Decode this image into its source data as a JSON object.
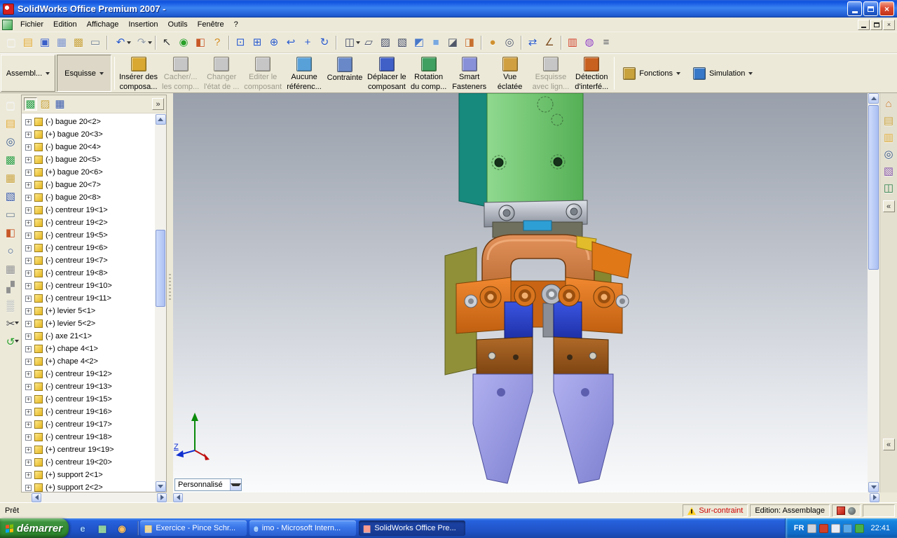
{
  "colors": {
    "titlebar_blue": "#1c5ae0",
    "taskbar_blue": "#245edb",
    "start_green": "#2f8a2f",
    "warning_red": "#cc0000",
    "viewport_gradient_top": "#99a0ab",
    "viewport_gradient_bottom": "#fafbfc",
    "ui_face": "#ece9d8"
  },
  "window": {
    "title": "SolidWorks Office Premium 2007 -",
    "controls": {
      "close": "×"
    }
  },
  "menu_bar": {
    "items": [
      {
        "name": "menu-fichier",
        "label": "Fichier"
      },
      {
        "name": "menu-edition",
        "label": "Edition"
      },
      {
        "name": "menu-affichage",
        "label": "Affichage"
      },
      {
        "name": "menu-insertion",
        "label": "Insertion"
      },
      {
        "name": "menu-outils",
        "label": "Outils"
      },
      {
        "name": "menu-fenetre",
        "label": "Fenêtre"
      },
      {
        "name": "menu-aide",
        "label": "?"
      }
    ]
  },
  "standard_toolbar": {
    "icons": [
      {
        "name": "new-icon",
        "g": "▢",
        "c": "#f0f0f0"
      },
      {
        "name": "open-icon",
        "g": "▤",
        "c": "#e0a830"
      },
      {
        "name": "save-icon",
        "g": "▣",
        "c": "#3a5fc8"
      },
      {
        "name": "make-drawing-icon",
        "g": "▦",
        "c": "#7890c8"
      },
      {
        "name": "make-assembly-icon",
        "g": "▩",
        "c": "#c8a23c"
      },
      {
        "name": "print-icon",
        "g": "▭",
        "c": "#708090"
      },
      {
        "name": "toolbar-separator",
        "cls": "sep"
      },
      {
        "name": "undo-icon",
        "g": "↶",
        "c": "#2858c8",
        "dd": 1
      },
      {
        "name": "redo-icon",
        "g": "↷",
        "c": "#98a0a8",
        "dd": 1
      },
      {
        "name": "toolbar-separator",
        "cls": "sep"
      },
      {
        "name": "select-icon",
        "g": "↖",
        "c": "#303030"
      },
      {
        "name": "rebuild-icon",
        "g": "◉",
        "c": "#28a028"
      },
      {
        "name": "appearance-icon",
        "g": "◧",
        "c": "#c85828"
      },
      {
        "name": "help-icon",
        "g": "?",
        "c": "#d08818"
      },
      {
        "name": "toolbar-separator",
        "cls": "sep"
      },
      {
        "name": "zoom-fit-icon",
        "g": "⊡",
        "c": "#2858c8"
      },
      {
        "name": "zoom-area-icon",
        "g": "⊞",
        "c": "#2858c8"
      },
      {
        "name": "zoom-in-out-icon",
        "g": "⊕",
        "c": "#2858c8"
      },
      {
        "name": "previous-view-icon",
        "g": "↩",
        "c": "#2858c8"
      },
      {
        "name": "pan-icon",
        "g": "+",
        "c": "#2858c8"
      },
      {
        "name": "rotate-view-icon",
        "g": "↻",
        "c": "#2858c8"
      },
      {
        "name": "toolbar-separator",
        "cls": "sep"
      },
      {
        "name": "standard-views-icon",
        "g": "◫",
        "c": "#404860",
        "dd": 1
      },
      {
        "name": "wireframe-icon",
        "g": "▱",
        "c": "#404860"
      },
      {
        "name": "hidden-lines-visible-icon",
        "g": "▨",
        "c": "#404860"
      },
      {
        "name": "hidden-lines-removed-icon",
        "g": "▧",
        "c": "#404860"
      },
      {
        "name": "shaded-with-edges-icon",
        "g": "◩",
        "c": "#4878c8"
      },
      {
        "name": "shaded-icon",
        "g": "■",
        "c": "#78a8e0"
      },
      {
        "name": "shadows-icon",
        "g": "◪",
        "c": "#505868"
      },
      {
        "name": "section-view-icon",
        "g": "◨",
        "c": "#c87030"
      },
      {
        "name": "toolbar-separator",
        "cls": "sep"
      },
      {
        "name": "realview-icon",
        "g": "●",
        "c": "#d09030"
      },
      {
        "name": "camera-icon",
        "g": "◎",
        "c": "#505868"
      },
      {
        "name": "toolbar-separator",
        "cls": "sep"
      },
      {
        "name": "mate-icon",
        "g": "⇄",
        "c": "#2858c8"
      },
      {
        "name": "measure-icon",
        "g": "∠",
        "c": "#805020"
      },
      {
        "name": "toolbar-separator",
        "cls": "sep"
      },
      {
        "name": "edrawings-icon",
        "g": "▥",
        "c": "#d04028"
      },
      {
        "name": "photoworks-icon",
        "g": "◍",
        "c": "#9040c0"
      },
      {
        "name": "options-icon",
        "g": "≡",
        "c": "#505050"
      }
    ]
  },
  "left_toolbar": {
    "icons": [
      {
        "name": "side-new-icon",
        "g": "▢",
        "c": "#f0f0f0"
      },
      {
        "name": "side-open-icon",
        "g": "▤",
        "c": "#e0a830"
      },
      {
        "name": "side-search-icon",
        "g": "◎",
        "c": "#385888"
      },
      {
        "name": "side-part-icon",
        "g": "▩",
        "c": "#30a048"
      },
      {
        "name": "side-assembly-icon",
        "g": "▦",
        "c": "#c8a23c"
      },
      {
        "name": "side-drawing-icon",
        "g": "▧",
        "c": "#3858a8"
      },
      {
        "name": "side-sheet-icon",
        "g": "▭",
        "c": "#708090"
      },
      {
        "name": "side-paint-icon",
        "g": "◧",
        "c": "#c85828"
      },
      {
        "name": "side-clock-icon",
        "g": "○",
        "c": "#385888"
      },
      {
        "name": "side-grid-icon",
        "g": "▦",
        "c": "#909090"
      },
      {
        "name": "side-pattern-icon",
        "g": "▞",
        "c": "#909090"
      },
      {
        "name": "side-texture-icon",
        "g": "▒",
        "c": "#98a0a8"
      },
      {
        "name": "side-cut-icon",
        "g": "✂",
        "c": "#404040",
        "dd": 1
      },
      {
        "name": "side-reload-icon",
        "g": "↺",
        "c": "#28a028",
        "dd": 1
      }
    ]
  },
  "command_manager": {
    "tabs": [
      {
        "name": "tab-assemblage",
        "label": "Assembl..."
      },
      {
        "name": "tab-esquisse",
        "label": "Esquisse",
        "cls": "active"
      }
    ],
    "buttons": [
      {
        "name": "insert-components-button",
        "l1": "Insérer des",
        "l2": "composa...",
        "c": "#d8a830"
      },
      {
        "name": "hide-show-components-button",
        "l1": "Cacher/...",
        "l2": "les comp...",
        "c": "#c6c6c6",
        "cls": "disabled"
      },
      {
        "name": "change-suppression-state-button",
        "l1": "Changer",
        "l2": "l'état de ...",
        "c": "#c6c6c6",
        "cls": "disabled"
      },
      {
        "name": "edit-component-button",
        "l1": "Editer le",
        "l2": "composant",
        "c": "#c6c6c6",
        "cls": "disabled"
      },
      {
        "name": "no-external-references-button",
        "l1": "Aucune",
        "l2": "référenc...",
        "c": "#58a0d8"
      },
      {
        "name": "mate-button",
        "l1": "Contrainte",
        "l2": "",
        "c": "#6888c8"
      },
      {
        "name": "move-component-button",
        "l1": "Déplacer le",
        "l2": "composant",
        "c": "#4060c8"
      },
      {
        "name": "rotate-component-button",
        "l1": "Rotation",
        "l2": "du comp...",
        "c": "#40a060"
      },
      {
        "name": "smart-fasteners-button",
        "l1": "Smart",
        "l2": "Fasteners",
        "c": "#8890d8"
      },
      {
        "name": "exploded-view-button",
        "l1": "Vue",
        "l2": "éclatée",
        "c": "#d0a040"
      },
      {
        "name": "explode-line-sketch-button",
        "l1": "Esquisse",
        "l2": "avec lign...",
        "c": "#c6c6c6",
        "cls": "disabled"
      },
      {
        "name": "interference-detection-button",
        "l1": "Détection",
        "l2": "d'interfé...",
        "c": "#c86020"
      }
    ],
    "group_buttons": [
      {
        "name": "fonctions-button",
        "label": "Fonctions",
        "c": "#c8a23c"
      },
      {
        "name": "simulation-button",
        "label": "Simulation",
        "c": "#3878c8"
      }
    ]
  },
  "feature_tree": {
    "expander_glyph": "+",
    "collapse_glyph": "»",
    "tabs": [
      {
        "name": "featuremanager-tab-icon",
        "g": "▩",
        "c": "#2fa04a",
        "cls": "active"
      },
      {
        "name": "propertymanager-tab-icon",
        "g": "▨",
        "c": "#c8a23c"
      },
      {
        "name": "configurationmanager-tab-icon",
        "g": "▦",
        "c": "#3858a8"
      }
    ],
    "items": [
      {
        "label": "(-) bague 20<2>"
      },
      {
        "label": "(+) bague 20<3>"
      },
      {
        "label": "(-) bague 20<4>"
      },
      {
        "label": "(-) bague 20<5>"
      },
      {
        "label": "(+) bague 20<6>"
      },
      {
        "label": "(-) bague 20<7>"
      },
      {
        "label": "(-) bague 20<8>"
      },
      {
        "label": "(-) centreur 19<1>"
      },
      {
        "label": "(-) centreur 19<2>"
      },
      {
        "label": "(-) centreur 19<5>"
      },
      {
        "label": "(-) centreur 19<6>"
      },
      {
        "label": "(-) centreur 19<7>"
      },
      {
        "label": "(-) centreur 19<8>"
      },
      {
        "label": "(-) centreur 19<10>"
      },
      {
        "label": "(-) centreur 19<11>"
      },
      {
        "label": "(+) levier 5<1>"
      },
      {
        "label": "(+) levier 5<2>"
      },
      {
        "label": "(-) axe 21<1>"
      },
      {
        "label": "(+) chape 4<1>"
      },
      {
        "label": "(+) chape 4<2>"
      },
      {
        "label": "(-) centreur 19<12>"
      },
      {
        "label": "(-) centreur 19<13>"
      },
      {
        "label": "(-) centreur 19<15>"
      },
      {
        "label": "(-) centreur 19<16>"
      },
      {
        "label": "(-) centreur 19<17>"
      },
      {
        "label": "(-) centreur 19<18>"
      },
      {
        "label": "(+) centreur 19<19>"
      },
      {
        "label": "(-) centreur 19<20>"
      },
      {
        "label": "(+) support 2<1>"
      },
      {
        "label": "(+) support 2<2>"
      }
    ]
  },
  "task_pane": {
    "collapse_glyph": "«",
    "icons": [
      {
        "name": "resources-home-icon",
        "g": "⌂",
        "c": "#c87828"
      },
      {
        "name": "design-library-icon",
        "g": "▤",
        "c": "#c8a23c"
      },
      {
        "name": "file-explorer-icon",
        "g": "▥",
        "c": "#e0b040"
      },
      {
        "name": "search-icon",
        "g": "◎",
        "c": "#385888"
      },
      {
        "name": "view-palette-icon",
        "g": "▧",
        "c": "#8858a8"
      },
      {
        "name": "document-recovery-icon",
        "g": "◫",
        "c": "#308048"
      }
    ]
  },
  "viewport": {
    "view_selector_value": "Personnalisé",
    "triad_z_label": "Z"
  },
  "status_bar": {
    "ready": "Prêt",
    "warning": "Sur-contraint",
    "edition": "Edition: Assemblage"
  },
  "taskbar": {
    "start_label": "démarrer",
    "quick_launch": [
      {
        "name": "quicklaunch-browser-icon",
        "g": "e",
        "c": "#9fd0ff"
      },
      {
        "name": "quicklaunch-desktop-icon",
        "g": "▦",
        "c": "#9fe0a0"
      },
      {
        "name": "quicklaunch-media-icon",
        "g": "◉",
        "c": "#ffc060"
      }
    ],
    "tasks": [
      {
        "name": "task-exercice",
        "label": "Exercice - Pince Schr...",
        "g": "▤",
        "c": "#ffd870"
      },
      {
        "name": "task-internet",
        "label": "imo - Microsoft Intern...",
        "g": "e",
        "c": "#a8d8ff"
      },
      {
        "name": "task-solidworks",
        "label": "SolidWorks Office Pre...",
        "g": "▩",
        "c": "#ff9888",
        "cls": "active"
      }
    ],
    "language": "FR",
    "tray_icons": [
      {
        "name": "tray-keyboard-icon",
        "c": "#d0d4dc"
      },
      {
        "name": "tray-antivirus-icon",
        "c": "#d04028"
      },
      {
        "name": "tray-volume-icon",
        "c": "#e8ecf4"
      },
      {
        "name": "tray-network-icon",
        "c": "#58a8e8"
      },
      {
        "name": "tray-messenger-icon",
        "c": "#48b048"
      }
    ],
    "time": "22:41"
  }
}
